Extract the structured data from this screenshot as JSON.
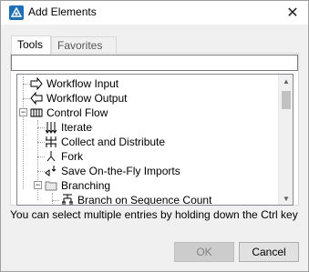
{
  "window": {
    "title": "Add Elements",
    "close_label": "✕"
  },
  "tabs": [
    {
      "label": "Tools",
      "active": true
    },
    {
      "label": "Favorites",
      "active": false
    }
  ],
  "search": {
    "value": "",
    "placeholder": ""
  },
  "tree": {
    "items": [
      {
        "label": "Workflow Input",
        "icon": "workflow-input-icon"
      },
      {
        "label": "Workflow Output",
        "icon": "workflow-output-icon"
      },
      {
        "label": "Control Flow",
        "icon": "control-flow-icon",
        "expanded": true
      },
      {
        "label": "Iterate",
        "icon": "iterate-icon"
      },
      {
        "label": "Collect and Distribute",
        "icon": "collect-distribute-icon"
      },
      {
        "label": "Fork",
        "icon": "fork-icon"
      },
      {
        "label": "Save On-the-Fly Imports",
        "icon": "save-imports-icon"
      },
      {
        "label": "Branching",
        "icon": "folder-icon",
        "expanded": true
      },
      {
        "label": "Branch on Sequence Count",
        "icon": "branch-icon"
      }
    ]
  },
  "hint": "You can select multiple entries by holding down the Ctrl key",
  "buttons": {
    "ok": "OK",
    "cancel": "Cancel"
  },
  "colors": {
    "accent": "#1f6fb5",
    "disabled_text": "#838383"
  }
}
